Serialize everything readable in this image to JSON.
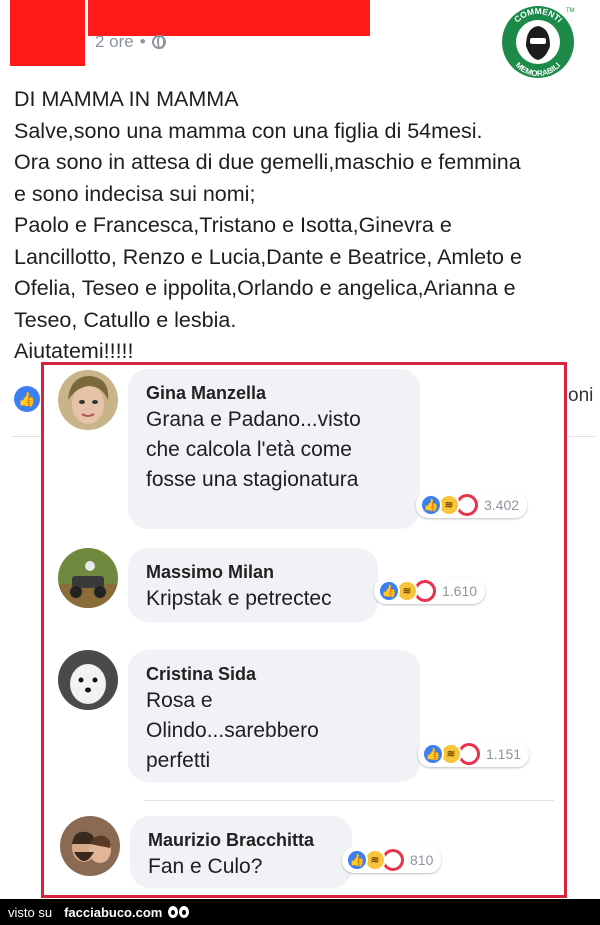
{
  "post": {
    "time": "2 ore",
    "dot": "•",
    "heading": "DI MAMMA IN MAMMA",
    "lines": [
      "Salve,sono una mamma con una figlia di 54mesi.",
      "Ora sono in attesa di due gemelli,maschio e femmina",
      "e sono indecisa sui nomi;",
      "Paolo e Francesca,Tristano e Isotta,Ginevra e",
      "Lancillotto, Renzo e Lucia,Dante e Beatrice, Amleto e",
      "Ofelia, Teseo e ippolita,Orlando e angelica,Arianna e",
      "Teseo, Catullo e lesbia.",
      "Aiutatemi!!!!!"
    ],
    "side_text": "oni"
  },
  "logo": {
    "top_text": "COMMENTI",
    "bottom_text": "MEMORABILI",
    "tm": "TM",
    "color": "#1e8a4a"
  },
  "comments": [
    {
      "name": "Gina Manzella",
      "lines": [
        "Grana e Padano...visto",
        "che calcola l'età come",
        "fosse una stagionatura"
      ],
      "count": "3.402"
    },
    {
      "name": "Massimo Milan",
      "lines": [
        "Kripstak e petrectec"
      ],
      "count": "1.610"
    },
    {
      "name": "Cristina Sida",
      "lines": [
        "Rosa e",
        "Olindo...sarebbero",
        "perfetti"
      ],
      "count": "1.151"
    },
    {
      "name": "Maurizio Bracchitta",
      "lines": [
        "Fan e Culo?"
      ],
      "count": "810"
    }
  ],
  "footer": {
    "prefix": "visto su",
    "site": "facciabuco.com"
  },
  "colors": {
    "frame": "#d6233f",
    "like": "#3b7ff0",
    "love": "#e8334d",
    "haha": "#f7c43a",
    "redaction": "#ff1a1a"
  }
}
